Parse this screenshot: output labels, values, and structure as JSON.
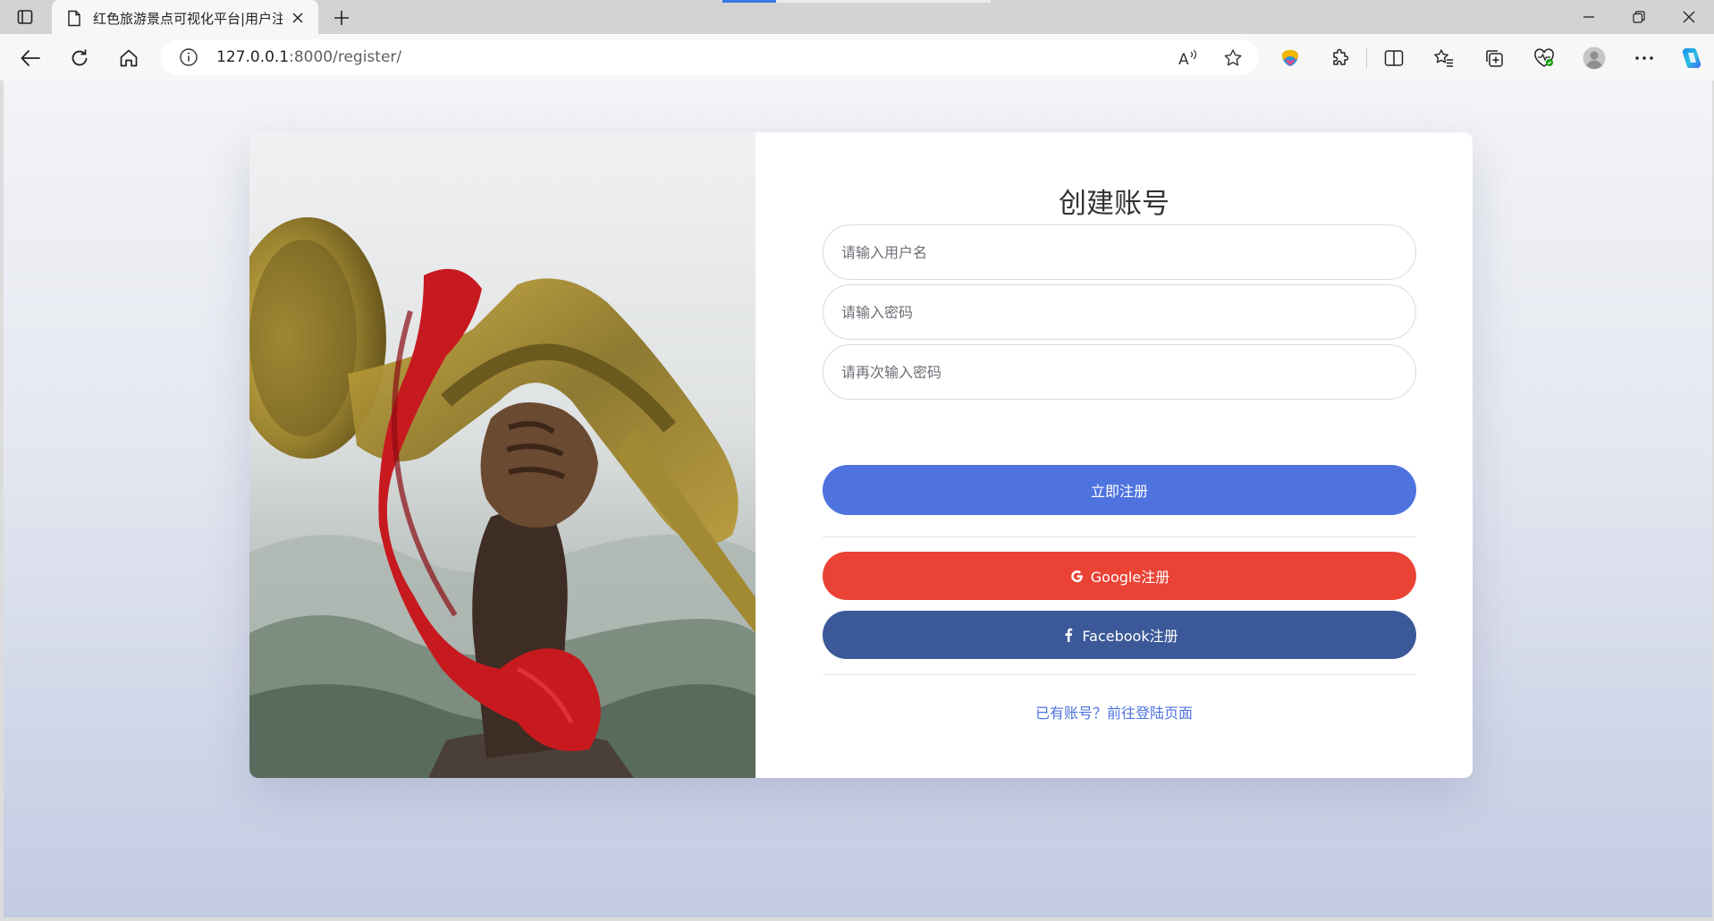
{
  "browser": {
    "tab_title": "红色旅游景点可视化平台|用户注册",
    "url_host": "127.0.0.1",
    "url_rest": ":8000/register/"
  },
  "icons": [
    "tab-actions-icon",
    "document-icon",
    "close-icon",
    "plus-icon",
    "back-icon",
    "refresh-icon",
    "home-icon",
    "info-icon",
    "read-aloud-icon",
    "favorite-star-icon",
    "extension-colorful-icon",
    "extensions-puzzle-icon",
    "split-screen-icon",
    "favorites-icon",
    "collections-icon",
    "browser-essentials-icon",
    "profile-icon",
    "more-icon",
    "copilot-icon",
    "google-icon",
    "facebook-icon"
  ],
  "register": {
    "heading": "创建账号",
    "username_placeholder": "请输入用户名",
    "password_placeholder": "请输入密码",
    "confirm_placeholder": "请再次输入密码",
    "submit_label": "立即注册",
    "google_label": "Google注册",
    "facebook_label": "Facebook注册",
    "login_link": "已有账号？前往登陆页面"
  },
  "colors": {
    "primary": "#4e73df",
    "google": "#ea4335",
    "facebook": "#3b5998"
  }
}
